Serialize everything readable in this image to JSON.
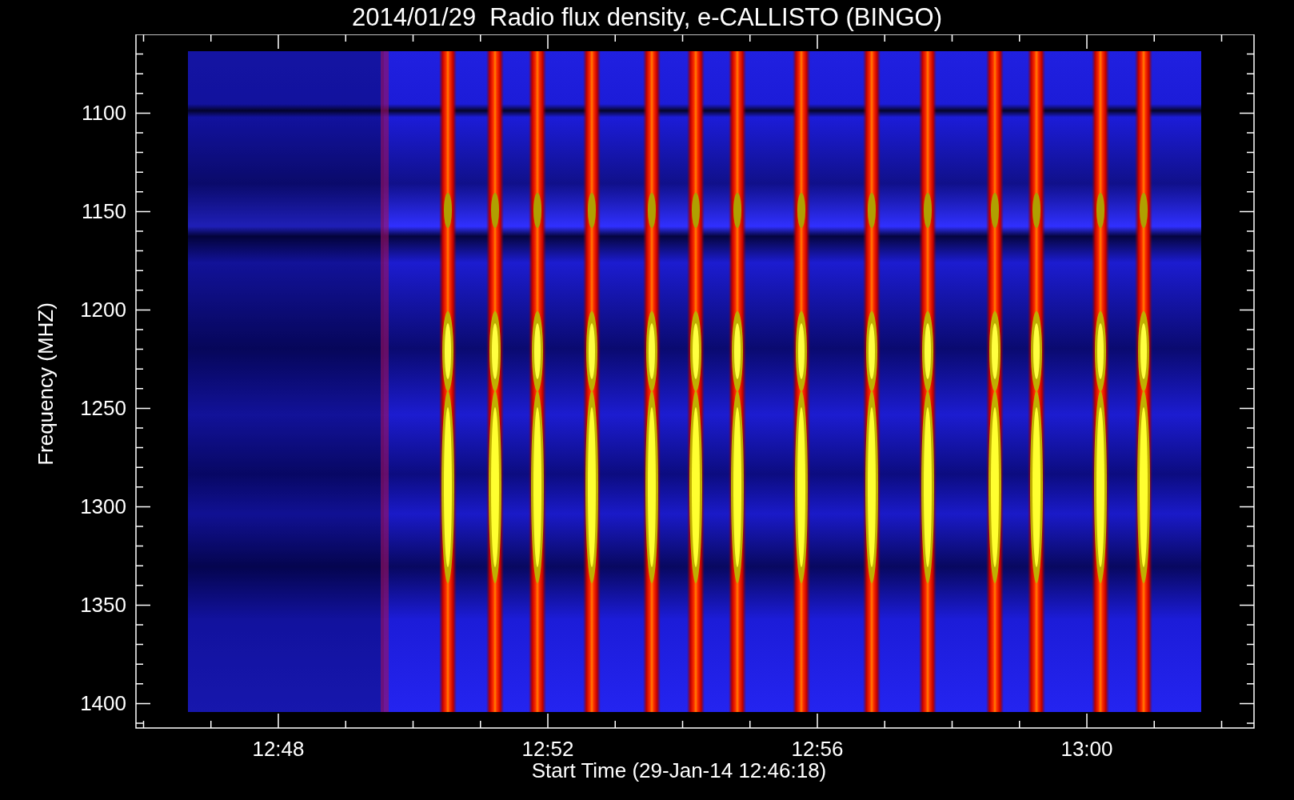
{
  "plot": {
    "title": "2014/01/29  Radio flux density, e-CALLISTO (BINGO)",
    "xlabel": "Start Time (29-Jan-14 12:46:18)",
    "ylabel": "Frequency (MHZ)",
    "y_ticks": [
      "1100",
      "1150",
      "1200",
      "1250",
      "1300",
      "1350",
      "1400"
    ],
    "x_ticks": [
      "12:48",
      "12:52",
      "12:56",
      "13:00"
    ]
  }
}
